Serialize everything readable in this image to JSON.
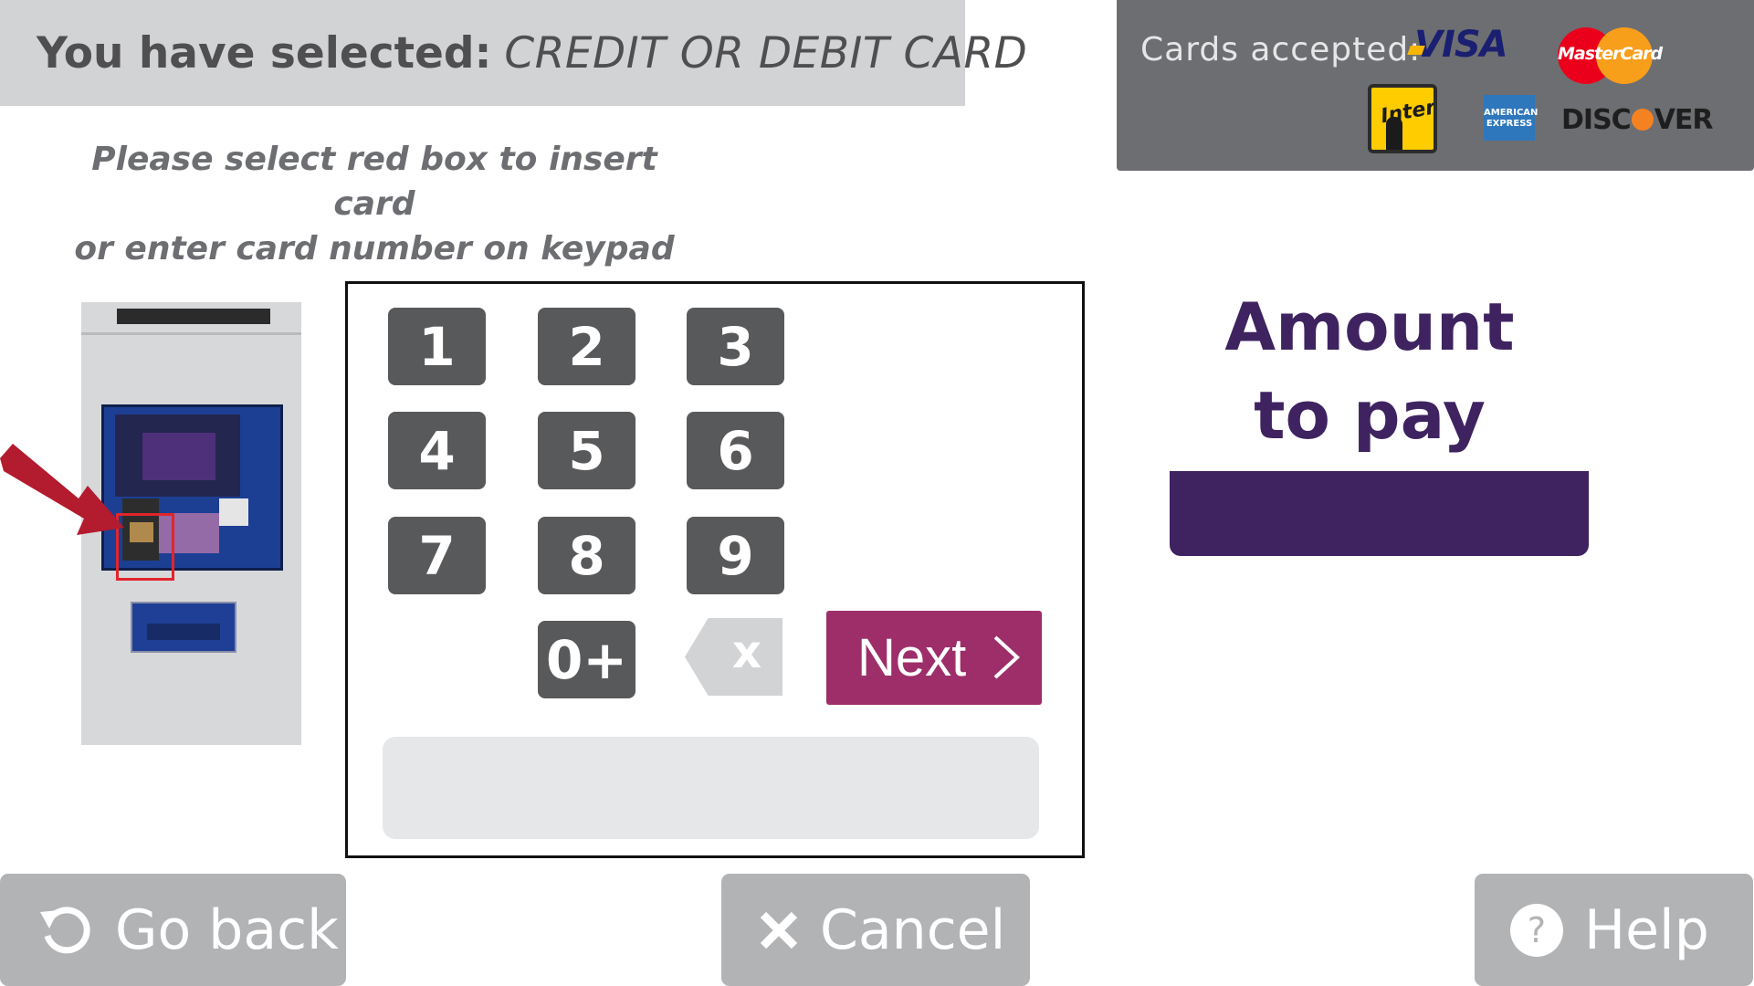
{
  "header": {
    "selected_prefix": "You have selected:",
    "selected_value": "CREDIT OR DEBIT CARD"
  },
  "instructions": {
    "line1": "Please select red box to insert card",
    "line2": "or enter card number on keypad"
  },
  "cards_accepted": {
    "label": "Cards accepted:",
    "logos": {
      "visa": "VISA",
      "mastercard": "MasterCard",
      "interac": "Interac",
      "amex": "AMERICAN EXPRESS",
      "discover": "DISCOVER"
    }
  },
  "keypad": {
    "keys": [
      "1",
      "2",
      "3",
      "4",
      "5",
      "6",
      "7",
      "8",
      "9",
      "0+"
    ],
    "backspace_label": "x",
    "next_label": "Next",
    "entry_value": ""
  },
  "amount": {
    "title_line1": "Amount",
    "title_line2": "to pay",
    "value": ""
  },
  "footer": {
    "go_back_label": "Go back",
    "cancel_label": "Cancel",
    "help_label": "Help"
  },
  "colors": {
    "accent_purple": "#3f2360",
    "next_magenta": "#9d2e6a",
    "key_dark": "#58595b",
    "highlight_red": "#e1252b"
  }
}
